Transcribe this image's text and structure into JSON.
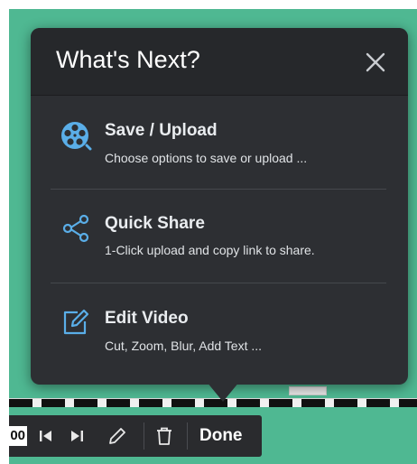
{
  "popup": {
    "title": "What's Next?",
    "close_icon": "close-icon",
    "options": [
      {
        "title": "Save / Upload",
        "description": "Choose options to save or upload ...",
        "icon": "film-reel-icon"
      },
      {
        "title": "Quick Share",
        "description": "1-Click upload and copy link to share.",
        "icon": "share-icon"
      },
      {
        "title": "Edit Video",
        "description": "Cut, Zoom, Blur, Add Text ...",
        "icon": "edit-icon"
      }
    ]
  },
  "toolbar": {
    "counter": "00",
    "icons": [
      "skip-back-icon",
      "skip-forward-icon",
      "pencil-icon",
      "trash-icon"
    ],
    "done_label": "Done"
  },
  "colors": {
    "background": "#4fb892",
    "popup": "#2d2f33",
    "popup_header": "#26282b",
    "accent_icon": "#5aaee8",
    "text": "#ffffff"
  }
}
